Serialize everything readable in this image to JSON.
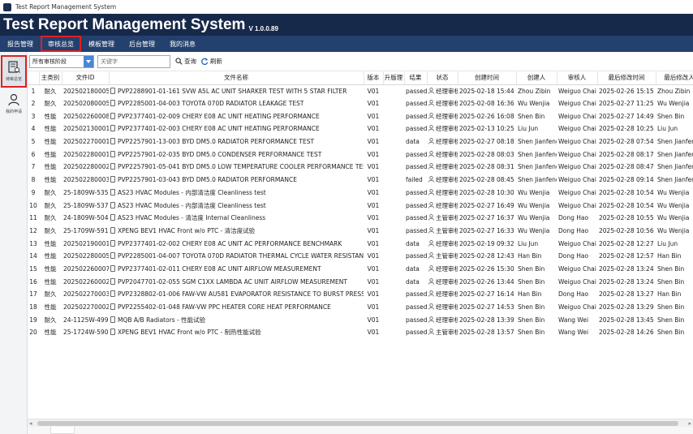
{
  "window": {
    "title": "Test Report Management System"
  },
  "header": {
    "title": "Test Report Management System",
    "version": "V 1.0.0.89"
  },
  "menu": [
    {
      "label": "报告管理",
      "active": false
    },
    {
      "label": "审核总览",
      "active": true
    },
    {
      "label": "模板管理",
      "active": false
    },
    {
      "label": "后台管理",
      "active": false
    },
    {
      "label": "我的消息",
      "active": false
    }
  ],
  "sidebar": [
    {
      "label": "待审总览",
      "icon": "review-list-icon",
      "active": true
    },
    {
      "label": "我的申请",
      "icon": "user-icon",
      "active": false
    }
  ],
  "toolbar": {
    "stage_select": "所有审核阶段",
    "search_placeholder": "关键字",
    "query_label": "查询",
    "refresh_label": "刷新"
  },
  "table": {
    "headers": [
      "",
      "主类别",
      "文件ID",
      "文件名称",
      "版本",
      "升版理",
      "结果",
      "状态",
      "创建时间",
      "创建人",
      "审核人",
      "最后修改时间",
      "最后修改人"
    ],
    "rows": [
      [
        "1",
        "耐久",
        "202502180005",
        "PVP2288901-01-161 SVW A5L AC UNIT SHARKER TEST WITH 5 STAR FILTER",
        "V01",
        "",
        "passed",
        "经理审核",
        "2025-02-18 15:44",
        "Zhou Zibin",
        "Weiguo Chai",
        "2025-02-26 15:15",
        "Zhou Zibin"
      ],
      [
        "2",
        "耐久",
        "202502080005",
        "PVP2285001-04-003 TOYOTA 070D RADIATOR LEAKAGE TEST",
        "V01",
        "",
        "passed",
        "经理审核",
        "2025-02-08 16:36",
        "Wu Wenjia",
        "Weiguo Chai",
        "2025-02-27 11:25",
        "Wu Wenjia"
      ],
      [
        "3",
        "性能",
        "202502260008",
        "PVP2377401-02-009 CHERY E08 AC UNIT HEATING PERFORMANCE",
        "V01",
        "",
        "passed",
        "经理审核",
        "2025-02-26 16:08",
        "Shen Bin",
        "Weiguo Chai",
        "2025-02-27 14:49",
        "Shen Bin"
      ],
      [
        "4",
        "性能",
        "202502130001",
        "PVP2377401-02-003 CHERY E08 AC UNIT HEATING PERFORMANCE",
        "V01",
        "",
        "passed",
        "经理审核",
        "2025-02-13 10:25",
        "Liu Jun",
        "Weiguo Chai",
        "2025-02-28 10:25",
        "Liu Jun"
      ],
      [
        "5",
        "性能",
        "202502270001",
        "PVP2257901-13-003 BYD DM5.0 RADIATOR PERFORMANCE TEST",
        "V01",
        "",
        "data",
        "经理审核",
        "2025-02-27 08:18",
        "Shen Jianfeng",
        "Weiguo Chai",
        "2025-02-28 07:54",
        "Shen Jianfeng"
      ],
      [
        "6",
        "性能",
        "202502280001",
        "PVP2257901-02-035 BYD DM5.0 CONDENSER PERFORMANCE TEST",
        "V01",
        "",
        "passed",
        "经理审核",
        "2025-02-28 08:03",
        "Shen Jianfeng",
        "Weiguo Chai",
        "2025-02-28 08:17",
        "Shen Jianfeng"
      ],
      [
        "7",
        "性能",
        "202502280002",
        "PVP2257901-05-041 BYD DM5.0 LOW TEMPERATURE COOLER PERFORMANCE TEST",
        "V01",
        "",
        "passed",
        "经理审核",
        "2025-02-28 08:31",
        "Shen Jianfeng",
        "Weiguo Chai",
        "2025-02-28 08:47",
        "Shen Jianfeng"
      ],
      [
        "8",
        "性能",
        "202502280003",
        "PVP2257901-03-043 BYD DM5.0 RADIATOR PERFORMANCE",
        "V01",
        "",
        "failed",
        "经理审核",
        "2025-02-28 08:45",
        "Shen Jianfeng",
        "Weiguo Chai",
        "2025-02-28 09:14",
        "Shen Jianfeng"
      ],
      [
        "9",
        "耐久",
        "25-1809W-535",
        "AS23 HVAC Modules - 内部清洁度 Cleanliness test",
        "V01",
        "",
        "passed",
        "经理审核",
        "2025-02-28 10:30",
        "Wu Wenjia",
        "Weiguo Chai",
        "2025-02-28 10:54",
        "Wu Wenjia"
      ],
      [
        "10",
        "耐久",
        "25-1809W-537",
        "AS23 HVAC Modules - 内部清洁度 Cleanliness test",
        "V01",
        "",
        "passed",
        "经理审核",
        "2025-02-27 16:49",
        "Wu Wenjia",
        "Weiguo Chai",
        "2025-02-28 10:54",
        "Wu Wenjia"
      ],
      [
        "11",
        "耐久",
        "24-1809W-504",
        "AS23 HVAC Modules - 清洁度 Internal Cleanliness",
        "V01",
        "",
        "passed",
        "主管审核",
        "2025-02-27 16:37",
        "Wu Wenjia",
        "Dong Hao",
        "2025-02-28 10:55",
        "Wu Wenjia"
      ],
      [
        "12",
        "耐久",
        "25-1709W-591",
        "XPENG BEV1 HVAC Front w/o PTC - 清洁度试验",
        "V01",
        "",
        "passed",
        "主管审核",
        "2025-02-27 16:33",
        "Wu Wenjia",
        "Dong Hao",
        "2025-02-28 10:56",
        "Wu Wenjia"
      ],
      [
        "13",
        "性能",
        "202502190001",
        "PVP2377401-02-002 CHERY E08 AC UNIT AC PERFORMANCE BENCHMARK",
        "V01",
        "",
        "data",
        "经理审核",
        "2025-02-19 09:32",
        "Liu Jun",
        "Weiguo Chai",
        "2025-02-28 12:27",
        "Liu Jun"
      ],
      [
        "14",
        "性能",
        "202502280005",
        "PVP2285001-04-007 TOYOTA 070D RADIATOR THERMAL CYCLE WATER RESISTANCE TEST",
        "V01",
        "",
        "passed",
        "主管审核",
        "2025-02-28 12:43",
        "Han Bin",
        "Dong Hao",
        "2025-02-28 12:57",
        "Han Bin"
      ],
      [
        "15",
        "性能",
        "202502260007",
        "PVP2377401-02-011 CHERY E08 AC UNIT AIRFLOW MEASUREMENT",
        "V01",
        "",
        "data",
        "经理审核",
        "2025-02-26 15:30",
        "Shen Bin",
        "Weiguo Chai",
        "2025-02-28 13:24",
        "Shen Bin"
      ],
      [
        "16",
        "性能",
        "202502260002",
        "PVP2047701-02-055 SGM C1XX LAMBDA AC UNIT AIRFLOW MEASUREMENT",
        "V01",
        "",
        "data",
        "经理审核",
        "2025-02-26 13:44",
        "Shen Bin",
        "Weiguo Chai",
        "2025-02-28 13:24",
        "Shen Bin"
      ],
      [
        "17",
        "耐久",
        "202502270003",
        "PVP2328802-01-006 FAW-VW AU581 EVAPORATOR RESISTANCE TO BURST PRESSURE TEST",
        "V01",
        "",
        "passed",
        "经理审核",
        "2025-02-27 16:14",
        "Han Bin",
        "Dong Hao",
        "2025-02-28 13:27",
        "Han Bin"
      ],
      [
        "18",
        "性能",
        "202502270002",
        "PVP2255402-01-048 FAW-VW PPC HEATER CORE HEAT PERFORMANCE",
        "V01",
        "",
        "passed",
        "经理审核",
        "2025-02-27 14:53",
        "Shen Bin",
        "Weiguo Chai",
        "2025-02-28 13:29",
        "Shen Bin"
      ],
      [
        "19",
        "耐久",
        "24-1125W-499",
        "MQB A/B Radiators - 性能试验",
        "V01",
        "",
        "passed",
        "经理审核",
        "2025-02-28 13:39",
        "Shen Bin",
        "Wang Wei",
        "2025-02-28 13:45",
        "Shen Bin"
      ],
      [
        "20",
        "性能",
        "25-1724W-590",
        "XPENG BEV1 HVAC Front w/o PTC - 制热性能试验",
        "V01",
        "",
        "passed",
        "主管审核",
        "2025-02-28 13:57",
        "Shen Bin",
        "Wang Wei",
        "2025-02-28 14:26",
        "Shen Bin"
      ]
    ]
  }
}
